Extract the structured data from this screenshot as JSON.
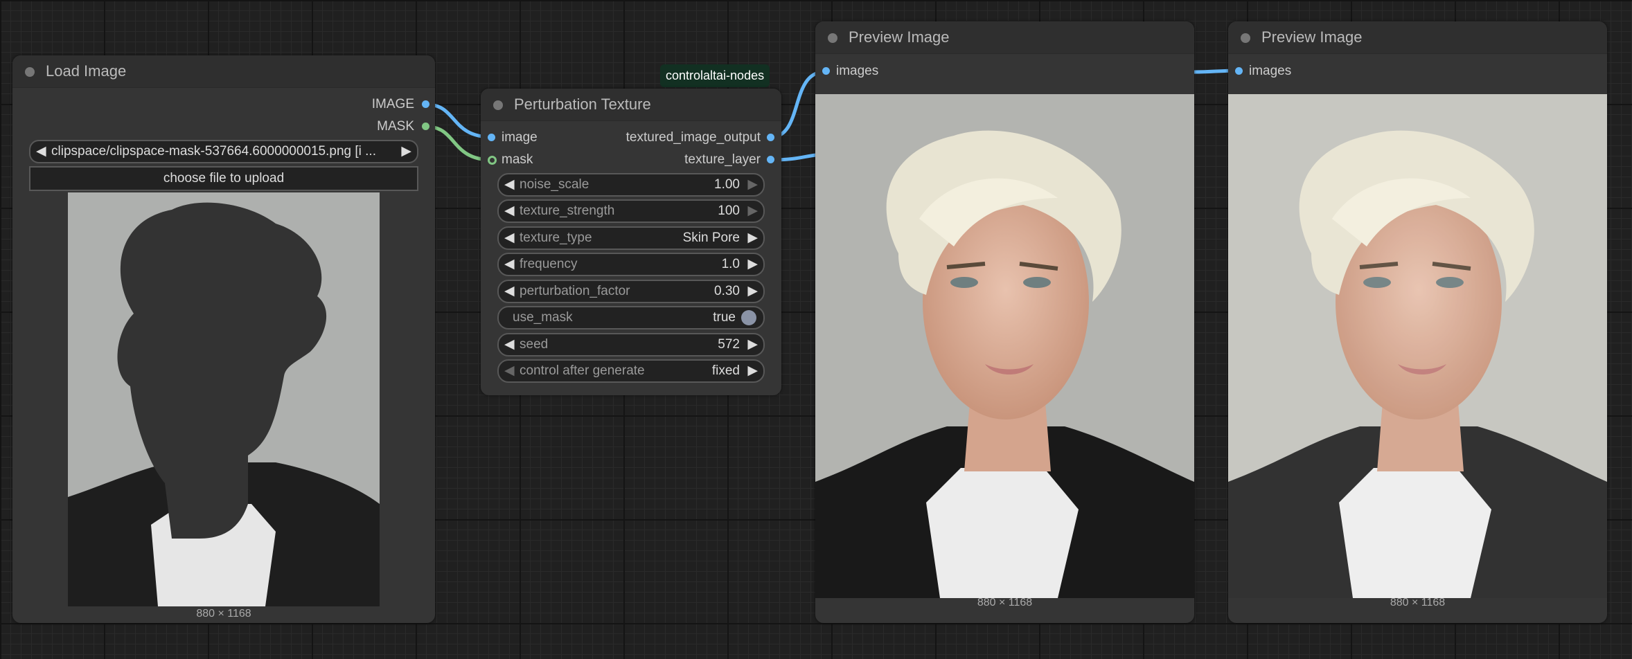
{
  "colors": {
    "image_link": "#64b5f6",
    "mask_link": "#81c784"
  },
  "load_image": {
    "title": "Load Image",
    "outputs": [
      "IMAGE",
      "MASK"
    ],
    "file_value": "clipspace/clipspace-mask-537664.6000000015.png [i ...",
    "upload_label": "choose file to upload",
    "dimensions": "880 × 1168"
  },
  "perturbation": {
    "badge": "controlaltai-nodes",
    "title": "Perturbation Texture",
    "inputs": [
      "image",
      "mask"
    ],
    "outputs": [
      "textured_image_output",
      "texture_layer"
    ],
    "widgets": [
      {
        "name": "noise_scale",
        "value": "1.00"
      },
      {
        "name": "texture_strength",
        "value": "100"
      },
      {
        "name": "texture_type",
        "value": "Skin Pore"
      },
      {
        "name": "frequency",
        "value": "1.0"
      },
      {
        "name": "perturbation_factor",
        "value": "0.30"
      },
      {
        "name": "use_mask",
        "value": "true"
      },
      {
        "name": "seed",
        "value": "572"
      },
      {
        "name": "control after generate",
        "value": "fixed"
      }
    ]
  },
  "preview1": {
    "title": "Preview Image",
    "input": "images",
    "dimensions": "880 × 1168"
  },
  "preview2": {
    "title": "Preview Image",
    "input": "images",
    "dimensions": "880 × 1168"
  }
}
